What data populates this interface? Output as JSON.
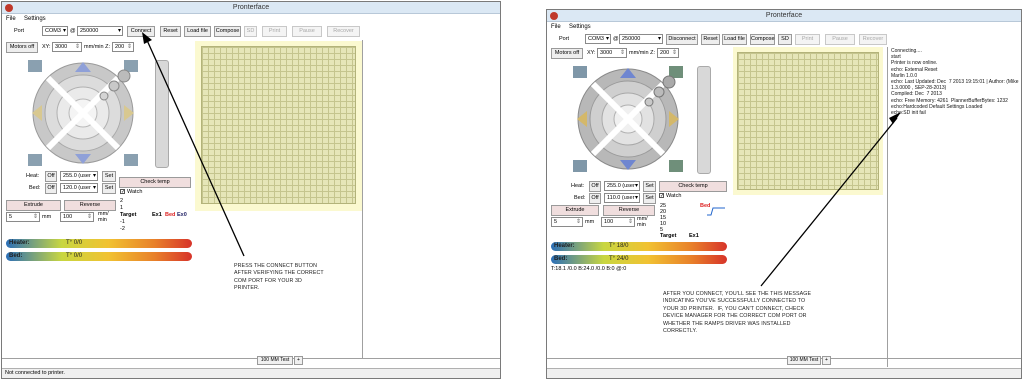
{
  "left": {
    "title": "Pronterface",
    "menu": {
      "file": "File",
      "settings": "Settings"
    },
    "toolbar": {
      "port_label": "Port",
      "port_value": "COM3",
      "at": "@",
      "baud_value": "250000",
      "connect": "Connect",
      "reset": "Reset",
      "load_file": "Load file",
      "compose": "Compose",
      "sd": "SD",
      "print": "Print",
      "pause": "Pause",
      "recover": "Recover"
    },
    "motors_off": "Motors off",
    "xy_label": "XY:",
    "xy_value": "3000",
    "z_label": "mm/min Z:",
    "z_value": "200",
    "heat_label": "Heat:",
    "bed_label": "Bed:",
    "off": "Off",
    "heat_value": "255.0 (user",
    "bed_value": "120.0 (user",
    "set": "Set",
    "check_temp": "Check temp",
    "watch": "Watch",
    "extrude": "Extrude",
    "reverse": "Reverse",
    "extrude_len": "5",
    "mm": "mm",
    "extrude_speed": "100",
    "mm_min": "mm/\nmin",
    "graph_ticks": [
      "2",
      "1",
      "0",
      "-1",
      "-2"
    ],
    "graph_legend": [
      "Target",
      "Ex1",
      "Bed",
      "Ex0"
    ],
    "heater_label": "Heater:",
    "heater_value": "T° 0/0",
    "bed_bar_label": "Bed:",
    "bed_bar_value": "T° 0/0",
    "tab_label": "100 MM Test",
    "tab_add": "+",
    "status": "Not connected to printer.",
    "annotation": "PRESS THE CONNECT BUTTON\nAFTER VERIFYING THE CORRECT\nCOM PORT FOR YOUR 3D\nPRINTER."
  },
  "right": {
    "title": "Pronterface",
    "menu": {
      "file": "File",
      "settings": "Settings"
    },
    "toolbar": {
      "port_label": "Port",
      "port_value": "COM3",
      "at": "@",
      "baud_value": "250000",
      "disconnect": "Disconnect",
      "reset": "Reset",
      "load_file": "Load file",
      "compose": "Compose",
      "sd": "SD",
      "print": "Print",
      "pause": "Pause",
      "recover": "Recover"
    },
    "motors_off": "Motors off",
    "xy_label": "XY:",
    "xy_value": "3000",
    "z_label": "mm/min Z:",
    "z_value": "200",
    "heat_label": "Heat:",
    "bed_label": "Bed:",
    "off": "Off",
    "heat_value": "255.0 (user",
    "bed_value": "110.0 (user",
    "set": "Set",
    "check_temp": "Check temp",
    "watch": "Watch",
    "extrude": "Extrude",
    "reverse": "Reverse",
    "extrude_len": "5",
    "mm": "mm",
    "extrude_speed": "100",
    "mm_min": "mm/\nmin",
    "graph_ticks": [
      "25",
      "20",
      "15",
      "10",
      "5",
      "0"
    ],
    "graph_legend": [
      "Target",
      "Ex1",
      "Bed"
    ],
    "heater_label": "Heater:",
    "heater_value": "T° 18/0",
    "bed_bar_label": "Bed:",
    "bed_bar_value": "T° 24/0",
    "temp_readout": "T:18.1 /0.0 B:24.0 /0.0 B:0 @:0",
    "console": "Connecting....\nstart\nPrinter is now online.\necho: External Reset\nMarlin 1.0.0\necho: Last Updated: Dec  7 2013 19:15:01 | Author: (Mike\n1.3.0000 , SEP-28-2013)\nCompiled: Dec  7 2013\necho: Free Memory: 4261  PlannerBufferBytes: 1232\necho:Hardcoded Default Settings Loaded\necho:SD init fail",
    "tab_label": "100 MM Test",
    "tab_add": "+",
    "annotation": "AFTER YOU CONNECT, YOU'LL SEE THE THIS MESSAGE\nINDICATING YOU'VE SUCCESSFULLY CONNECTED TO\nYOUR 3D PRINTER.  IF, YOU CAN'T CONNECT, CHECK\nDEVICE MANAGER FOR THE CORRECT COM PORT OR\nWHETHER THE RAMPS DRIVER WAS INSTALLED\nCORRECTLY."
  }
}
